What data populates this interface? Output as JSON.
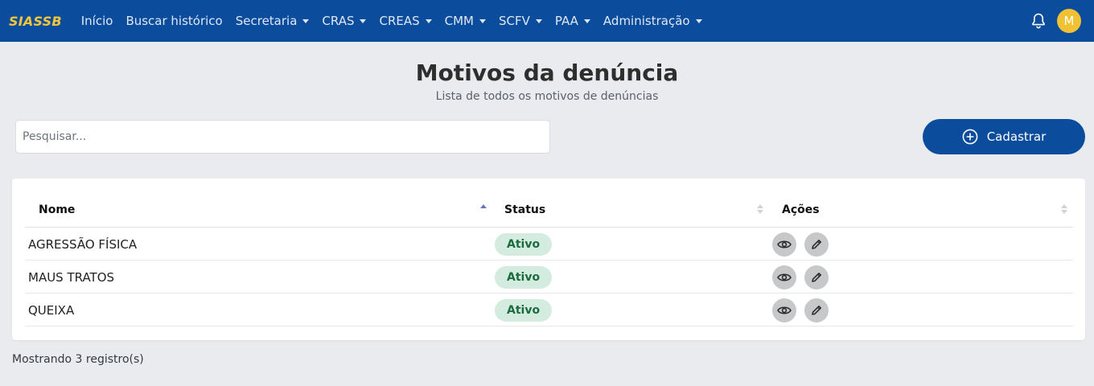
{
  "navbar": {
    "brand": "SIASSB",
    "items": [
      {
        "label": "Início",
        "dropdown": false
      },
      {
        "label": "Buscar histórico",
        "dropdown": false
      },
      {
        "label": "Secretaria",
        "dropdown": true
      },
      {
        "label": "CRAS",
        "dropdown": true
      },
      {
        "label": "CREAS",
        "dropdown": true
      },
      {
        "label": "CMM",
        "dropdown": true
      },
      {
        "label": "SCFV",
        "dropdown": true
      },
      {
        "label": "PAA",
        "dropdown": true
      },
      {
        "label": "Administração",
        "dropdown": true
      }
    ],
    "avatar_initial": "M"
  },
  "page": {
    "title": "Motivos da denúncia",
    "subtitle": "Lista de todos os motivos de denúncias"
  },
  "search": {
    "placeholder": "Pesquisar..."
  },
  "add_button": {
    "label": "Cadastrar"
  },
  "table": {
    "columns": [
      "Nome",
      "Status",
      "Ações"
    ],
    "rows": [
      {
        "nome": "AGRESSÃO FÍSICA",
        "status": "Ativo"
      },
      {
        "nome": "MAUS TRATOS",
        "status": "Ativo"
      },
      {
        "nome": "QUEIXA",
        "status": "Ativo"
      }
    ]
  },
  "footer": {
    "info": "Mostrando 3 registro(s)"
  },
  "colors": {
    "primary": "#0b4d9c",
    "brand": "#f5c63c",
    "badge_bg": "#d4ebe0",
    "badge_text": "#1c6b3f"
  }
}
